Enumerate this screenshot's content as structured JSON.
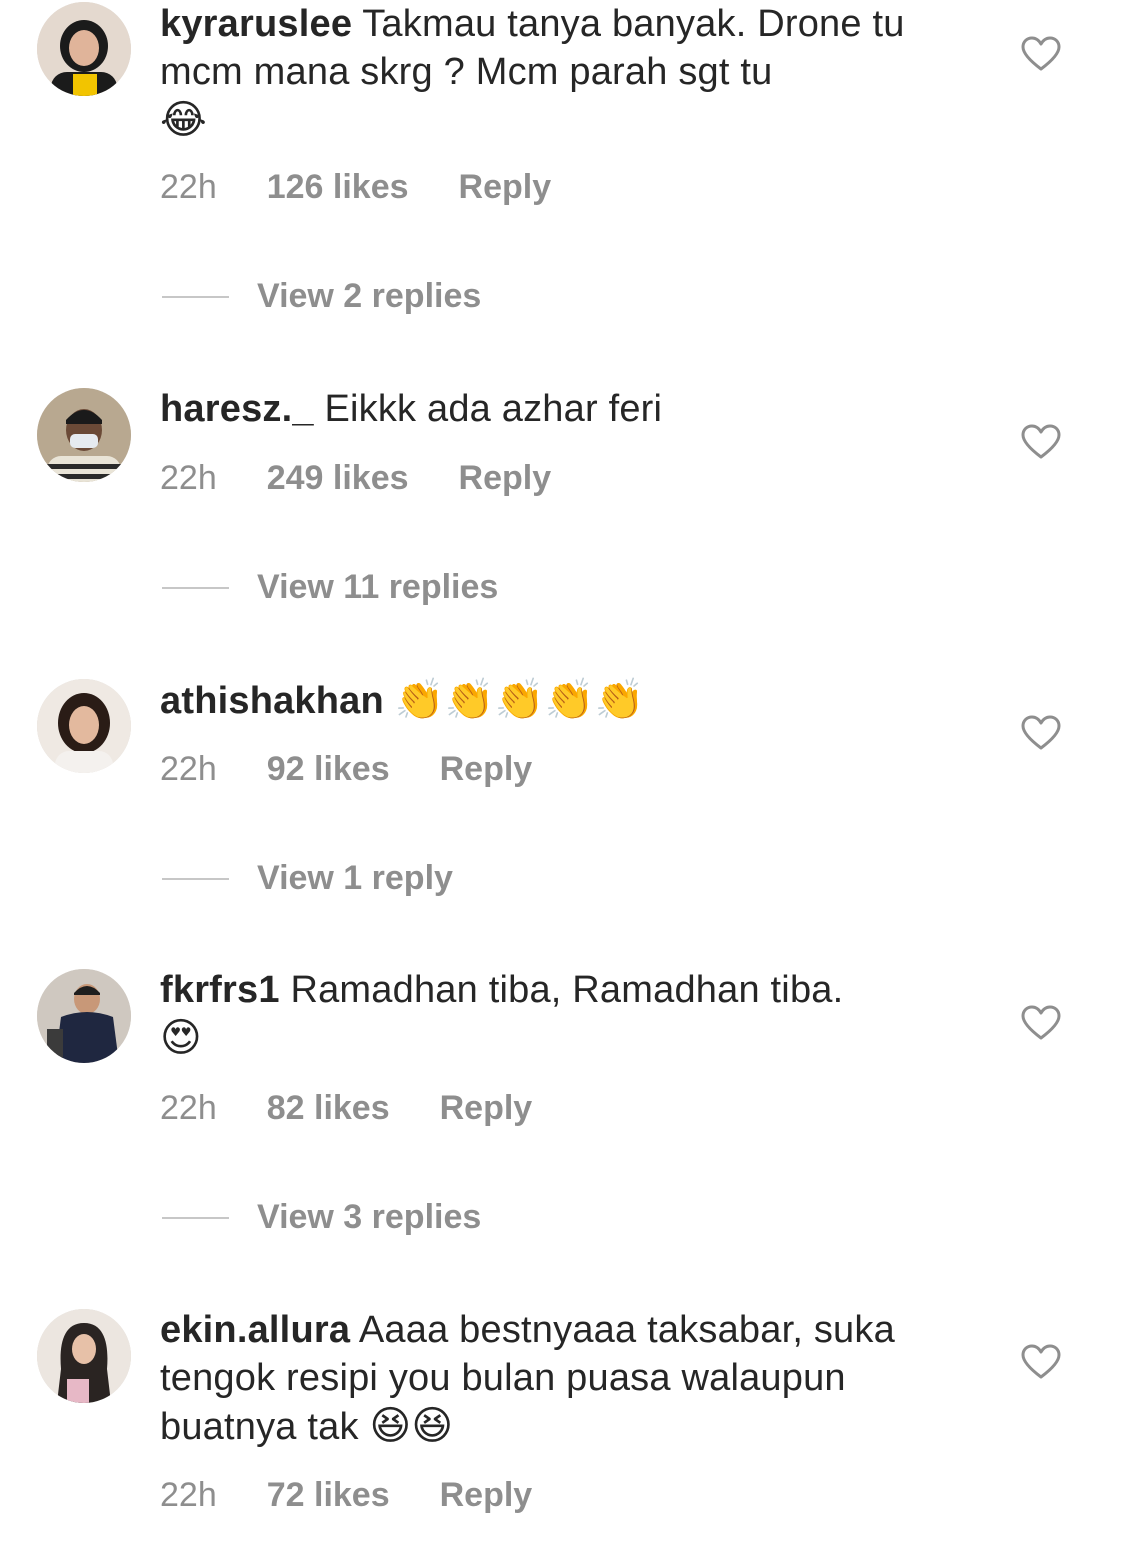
{
  "comments": [
    {
      "username": "kyraruslee",
      "text": "Takmau tanya banyak. Drone tu mcm mana skrg ? Mcm parah sgt tu",
      "emoji": "😂",
      "time": "22h",
      "likes": "126 likes",
      "reply_label": "Reply",
      "view_replies": "View 2 replies"
    },
    {
      "username": "haresz._",
      "text": "Eikkk ada azhar feri",
      "emoji": "",
      "time": "22h",
      "likes": "249 likes",
      "reply_label": "Reply",
      "view_replies": "View 11 replies"
    },
    {
      "username": "athishakhan",
      "text": "",
      "emoji": "👏👏👏👏👏",
      "time": "22h",
      "likes": "92 likes",
      "reply_label": "Reply",
      "view_replies": "View 1 reply"
    },
    {
      "username": "fkrfrs1",
      "text": "Ramadhan tiba, Ramadhan tiba.",
      "emoji": "😍",
      "time": "22h",
      "likes": "82 likes",
      "reply_label": "Reply",
      "view_replies": "View 3 replies"
    },
    {
      "username": "ekin.allura",
      "text": "Aaaa bestnyaaa taksabar, suka tengok resipi you bulan puasa walaupun buatnya tak",
      "emoji": "😆😆",
      "time": "22h",
      "likes": "72 likes",
      "reply_label": "Reply"
    }
  ],
  "icons": {
    "like": "heart-outline-icon",
    "avatar": "user-avatar"
  },
  "colors": {
    "text": "#262626",
    "secondary": "#8e8e8e",
    "divider": "#c7c7c7"
  }
}
